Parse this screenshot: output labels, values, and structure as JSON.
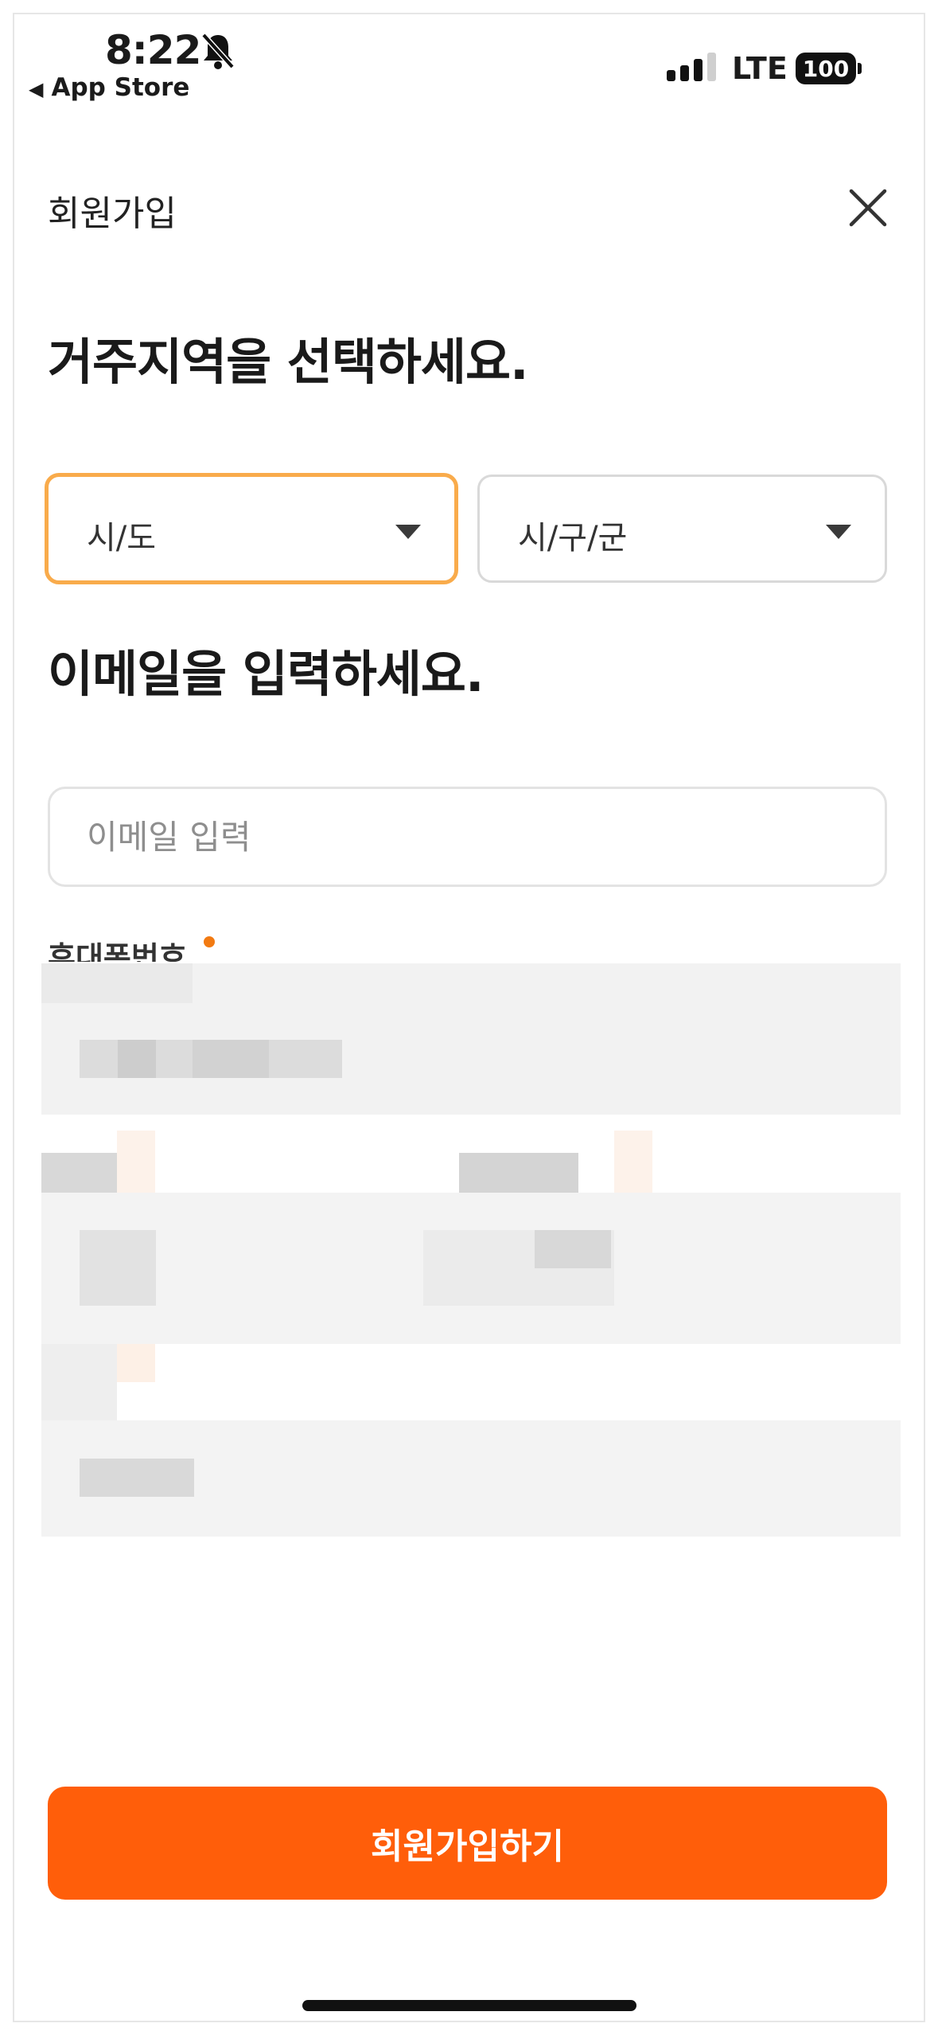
{
  "status_bar": {
    "time": "8:22",
    "back_app": "App Store",
    "network": "LTE",
    "battery": "100"
  },
  "header": {
    "title": "회원가입"
  },
  "region": {
    "heading": "거주지역을 선택하세요.",
    "province_select": "시/도",
    "district_select": "시/구/군"
  },
  "email": {
    "heading": "이메일을 입력하세요.",
    "placeholder": "이메일 입력"
  },
  "phone": {
    "label": "휴대폰번호"
  },
  "submit": {
    "label": "회원가입하기"
  },
  "colors": {
    "accent": "#ff5e0a",
    "focus_border": "#f9ab4b",
    "required_dot": "#f27a12"
  }
}
